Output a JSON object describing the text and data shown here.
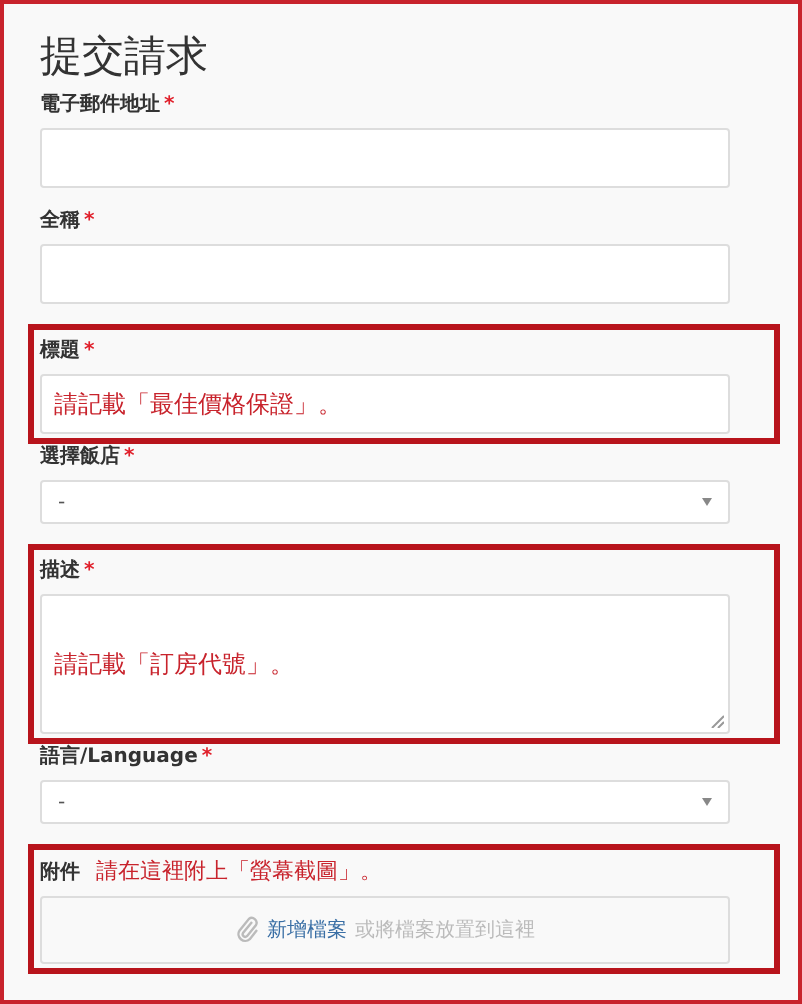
{
  "title": "提交請求",
  "fields": [
    {
      "kind": "input",
      "label": "電子郵件地址",
      "mark": "*",
      "highlighted": false
    },
    {
      "kind": "input",
      "label": "全稱",
      "mark": "*",
      "highlighted": false
    },
    {
      "kind": "input",
      "label": "標題",
      "mark": "*",
      "value": "請記載「最佳價格保證」。",
      "highlighted": true
    },
    {
      "kind": "select",
      "label": "選擇飯店",
      "mark": "*",
      "value": "-",
      "highlighted": false
    },
    {
      "kind": "textarea",
      "label": "描述",
      "mark": "*",
      "value": "請記載「訂房代號」。",
      "highlighted": true
    },
    {
      "kind": "select",
      "label": "語言/Language",
      "mark": "*",
      "value": "-",
      "highlighted": false
    },
    {
      "kind": "attachment",
      "label": "附件",
      "note": "請在這裡附上「螢幕截圖」。",
      "link": "新增檔案",
      "hint": "或將檔案放置到這裡",
      "highlighted": true
    }
  ]
}
